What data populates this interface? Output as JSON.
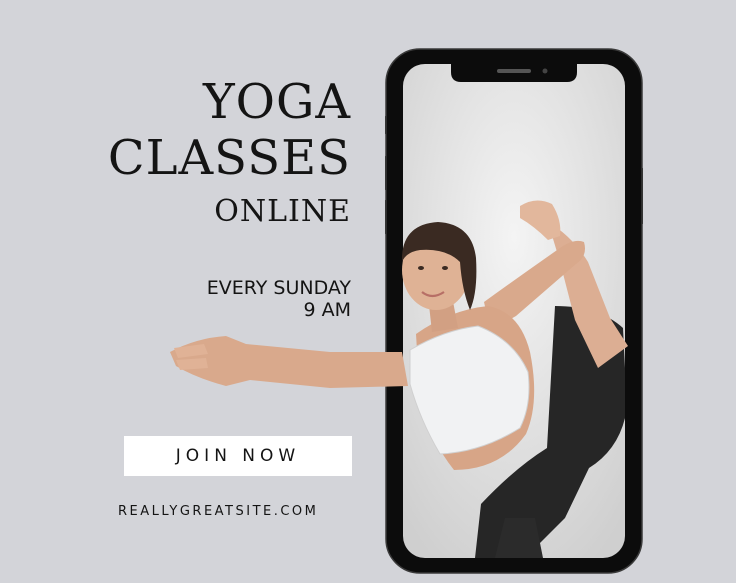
{
  "headline": {
    "line1": "YOGA",
    "line2": "CLASSES",
    "line3": "ONLINE"
  },
  "schedule": {
    "day": "EVERY SUNDAY",
    "time": "9 AM"
  },
  "cta": {
    "label": "JOIN NOW"
  },
  "website": "REALLYGREATSITE.COM",
  "colors": {
    "background": "#d3d4d9",
    "text": "#141414",
    "button": "#ffffff"
  }
}
